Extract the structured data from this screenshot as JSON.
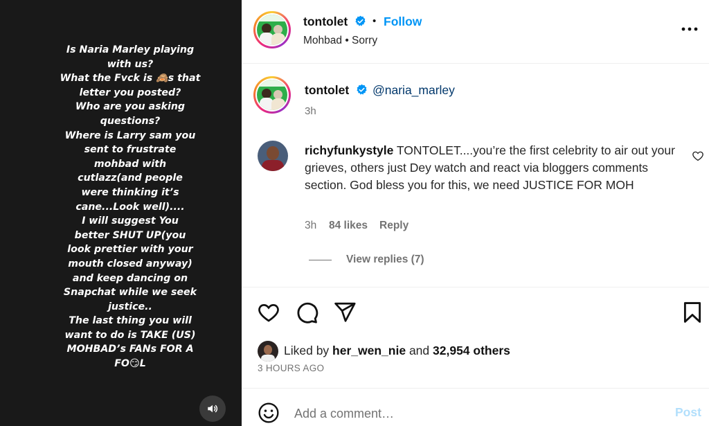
{
  "media": {
    "story_lines": [
      "Is Naria Marley playing",
      "with us?",
      "What the Fvck is 🙈s that",
      "letter you posted?",
      "Who are you asking",
      "questions?",
      "Where is Larry sam you",
      "sent to frustrate",
      "mohbad with",
      "cutlazz(and people",
      "were thinking it’s",
      "cane...Look well)....",
      "I will suggest You",
      "better SHUT UP(you",
      "look prettier with your",
      "mouth closed anyway)",
      "and keep dancing on",
      "Snapchat while we seek",
      "justice..",
      "The last thing you will",
      "want to do is TAKE (US)",
      "MOHBAD’s FANs FOR A",
      "FO😏L"
    ],
    "sound_icon": "speaker-icon"
  },
  "header": {
    "username": "tontolet",
    "separator": "•",
    "follow_label": "Follow",
    "subtitle": "Mohbad • Sorry",
    "more_icon": "more-horizontal-icon"
  },
  "caption": {
    "username": "tontolet",
    "mention": "@naria_marley",
    "time": "3h"
  },
  "comment": {
    "username": "richyfunkystyle",
    "text": " TONTOLET....you’re the first celebrity to air out your grieves, others just Dey watch and react via bloggers comments section. God bless you for this, we need JUSTICE FOR MOH",
    "time": "3h",
    "likes": "84 likes",
    "reply_label": "Reply",
    "view_replies": "View replies (7)"
  },
  "actions": {
    "like_icon": "heart-icon",
    "comment_icon": "comment-icon",
    "share_icon": "share-icon",
    "save_icon": "bookmark-icon"
  },
  "likes": {
    "prefix": "Liked by ",
    "user": "her_wen_nie",
    "middle": " and ",
    "others": "32,954 others"
  },
  "date": "3 HOURS AGO",
  "add_comment": {
    "placeholder": "Add a comment…",
    "post_label": "Post"
  },
  "colors": {
    "accent": "#0095f6",
    "verified": "#0095f6",
    "media_bg": "#191919",
    "post_disabled": "#b2dffc"
  }
}
